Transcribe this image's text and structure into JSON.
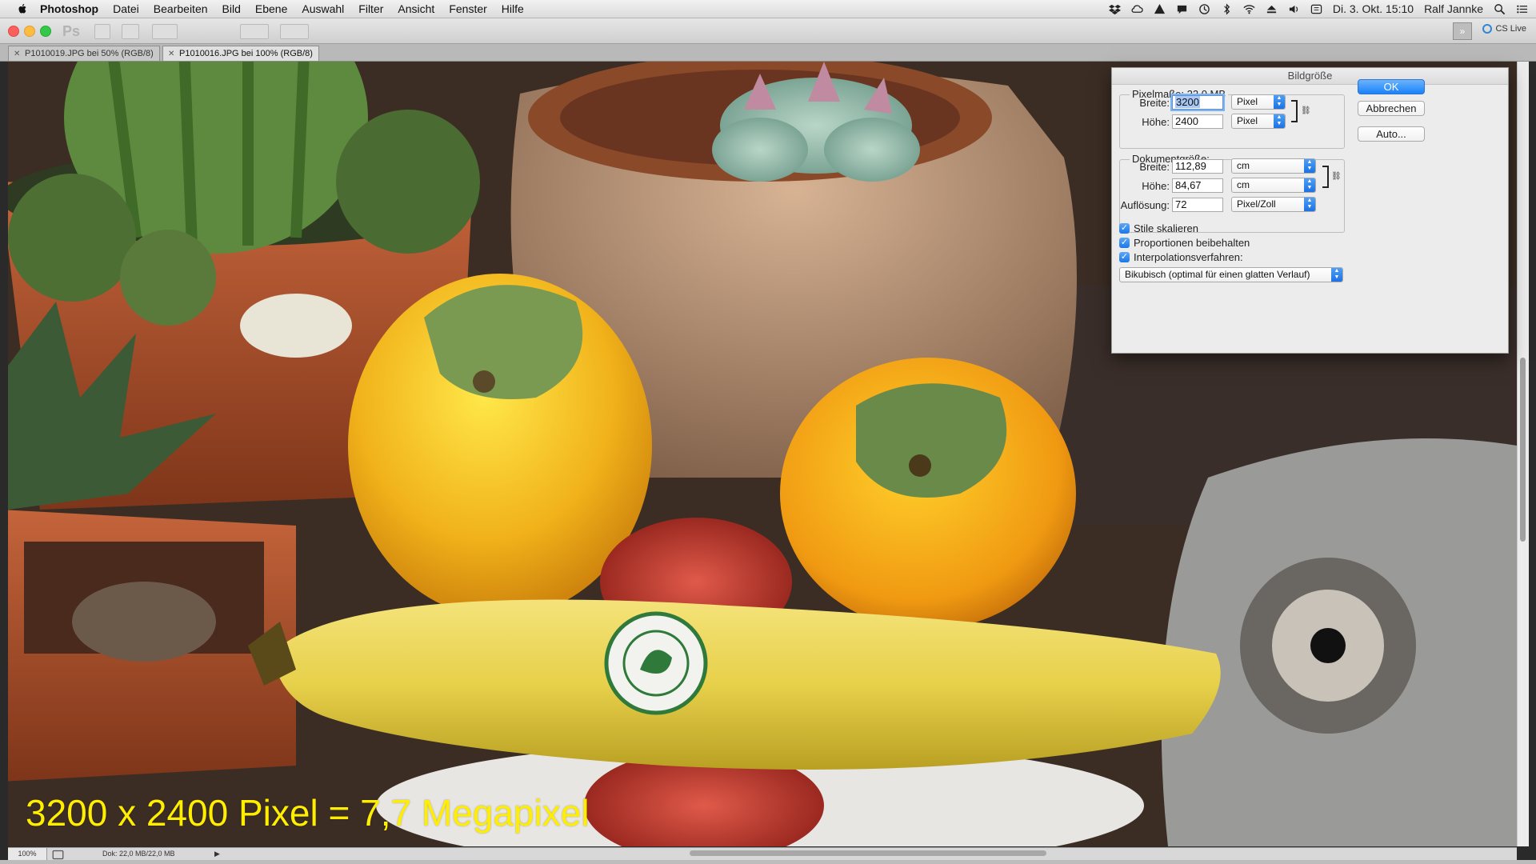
{
  "menubar": {
    "app_name": "Photoshop",
    "items": [
      "Datei",
      "Bearbeiten",
      "Bild",
      "Ebene",
      "Auswahl",
      "Filter",
      "Ansicht",
      "Fenster",
      "Hilfe"
    ],
    "clock": "Di. 3. Okt. 15:10",
    "user": "Ralf Jannke"
  },
  "appbar": {
    "logo": "Ps",
    "cs_live": "CS Live"
  },
  "tabs": [
    {
      "label": "P1010019.JPG bei 50% (RGB/8)",
      "active": false
    },
    {
      "label": "P1010016.JPG bei 100% (RGB/8)",
      "active": true
    }
  ],
  "canvas": {
    "caption": "3200 x 2400 Pixel = 7,7 Megapixel"
  },
  "statusbar": {
    "zoom": "100%",
    "doc_info": "Dok: 22,0 MB/22,0 MB"
  },
  "dialog": {
    "title": "Bildgröße",
    "pixel_group": {
      "title": "Pixelmaße: 22,0 MB",
      "width_label": "Breite:",
      "width_value": "3200",
      "width_unit": "Pixel",
      "height_label": "Höhe:",
      "height_value": "2400",
      "height_unit": "Pixel"
    },
    "doc_group": {
      "title": "Dokumentgröße:",
      "width_label": "Breite:",
      "width_value": "112,89",
      "width_unit": "cm",
      "height_label": "Höhe:",
      "height_value": "84,67",
      "height_unit": "cm",
      "resolution_label": "Auflösung:",
      "resolution_value": "72",
      "resolution_unit": "Pixel/Zoll"
    },
    "checkboxes": [
      {
        "label": "Stile skalieren",
        "checked": true
      },
      {
        "label": "Proportionen beibehalten",
        "checked": true
      },
      {
        "label": "Interpolationsverfahren:",
        "checked": true
      }
    ],
    "interpolation": "Bikubisch (optimal für einen glatten Verlauf)",
    "buttons": {
      "ok": "OK",
      "cancel": "Abbrechen",
      "auto": "Auto..."
    }
  }
}
